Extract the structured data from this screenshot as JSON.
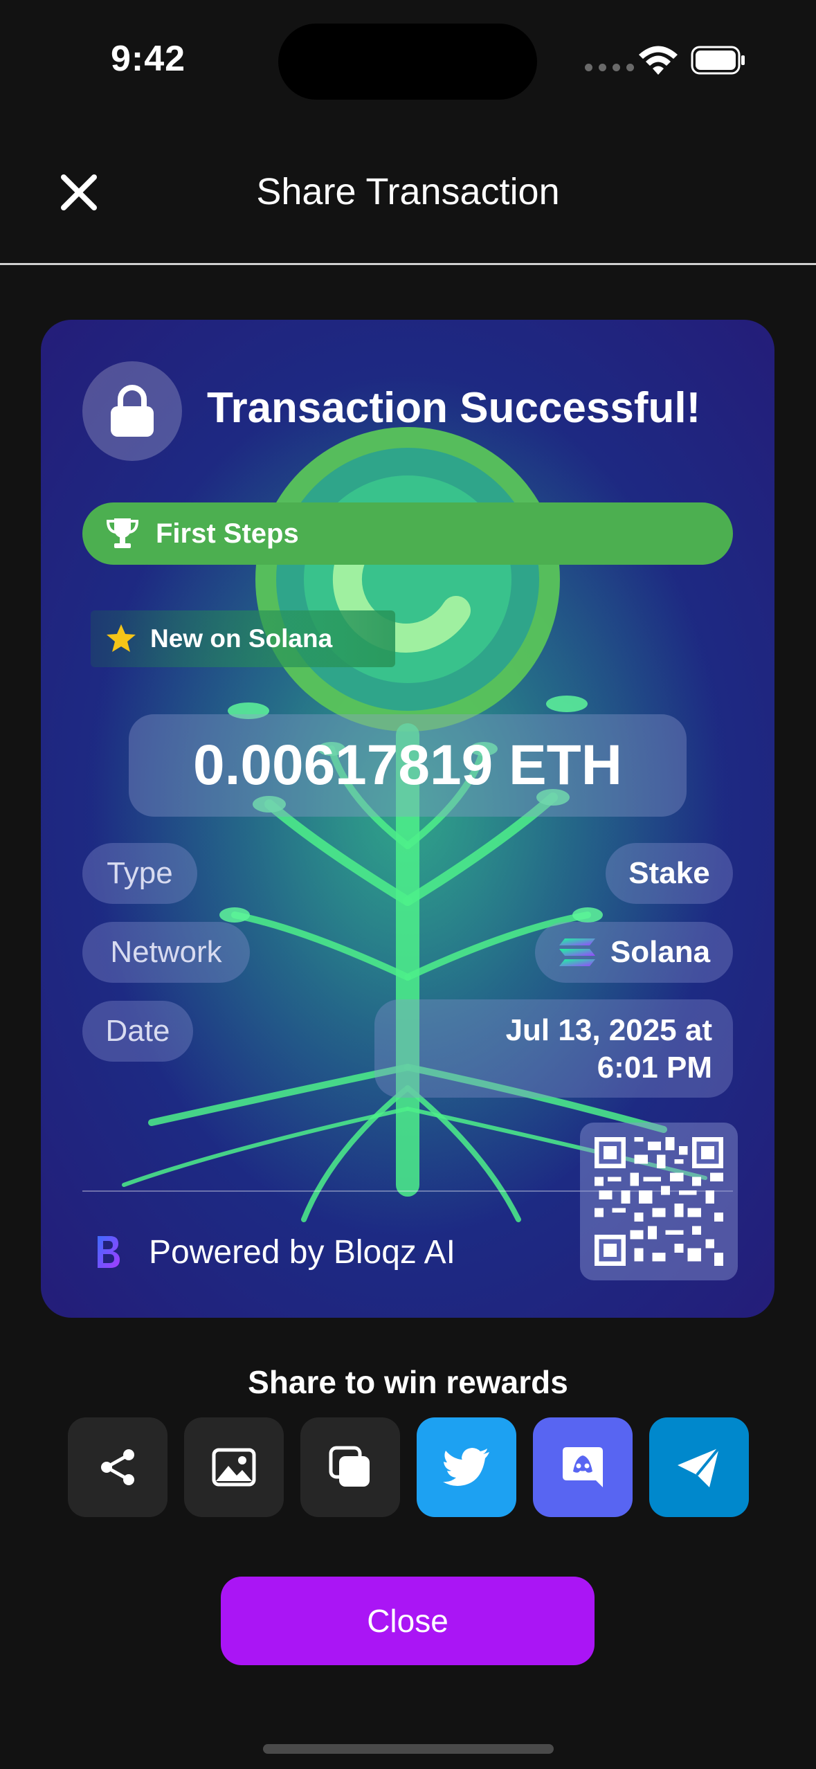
{
  "status_bar": {
    "time": "9:42",
    "icons": [
      "cellular-signal-icon",
      "wifi-icon",
      "battery-icon"
    ]
  },
  "header": {
    "title": "Share Transaction",
    "close_icon": "close-icon"
  },
  "card": {
    "icon": "lock-icon",
    "title": "Transaction Successful!",
    "achievement": {
      "icon": "trophy-icon",
      "label": "First Steps"
    },
    "badge": {
      "icon": "star-icon",
      "label": "New on Solana"
    },
    "amount": "0.00617819 ETH",
    "details": {
      "type_label": "Type",
      "type_value": "Stake",
      "network_label": "Network",
      "network_value": "Solana",
      "network_icon": "solana-logo-icon",
      "date_label": "Date",
      "date_line1": "Jul 13, 2025 at",
      "date_line2": "6:01 PM"
    },
    "qr_icon": "qr-code-icon",
    "footer": {
      "logo_icon": "bloqz-logo-icon",
      "text": "Powered by Bloqz AI"
    }
  },
  "share": {
    "title": "Share to win rewards",
    "buttons": [
      {
        "name": "share",
        "icon": "share-icon",
        "color": "#262626"
      },
      {
        "name": "save-image",
        "icon": "image-icon",
        "color": "#262626"
      },
      {
        "name": "copy",
        "icon": "copy-icon",
        "color": "#262626"
      },
      {
        "name": "twitter",
        "icon": "twitter-icon",
        "color": "#1da1f2"
      },
      {
        "name": "discord",
        "icon": "discord-icon",
        "color": "#5865f2"
      },
      {
        "name": "telegram",
        "icon": "telegram-icon",
        "color": "#0088cc"
      }
    ]
  },
  "close_button": {
    "label": "Close",
    "color": "#aa15f5"
  },
  "colors": {
    "background": "#121212",
    "achievement_green": "#4caf50",
    "card_blue": "#1d2a83"
  }
}
